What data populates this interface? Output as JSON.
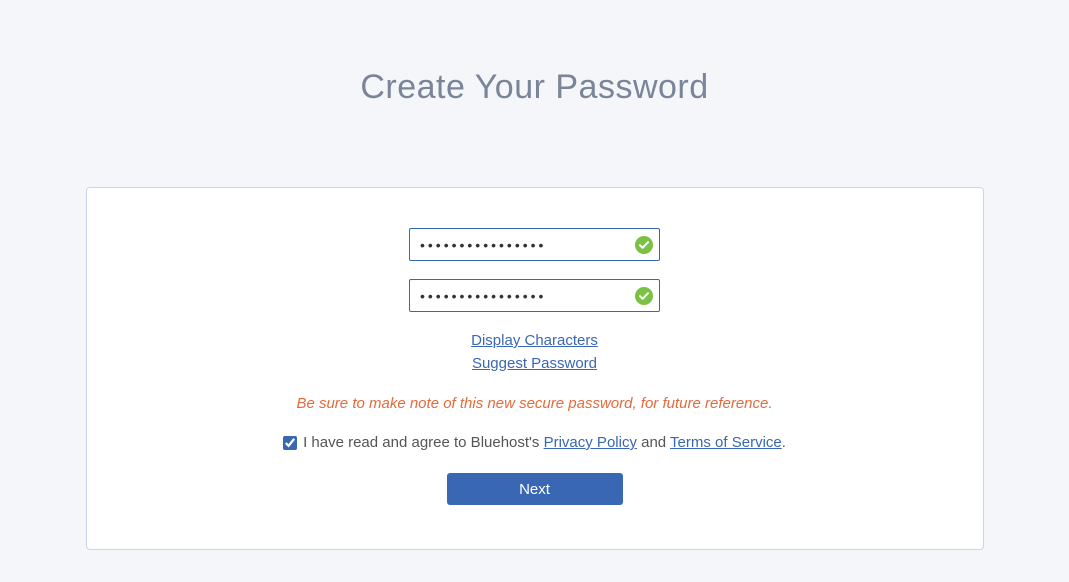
{
  "heading": "Create Your Password",
  "password": {
    "value": "••••••••••••••••",
    "valid": true
  },
  "confirm": {
    "value": "••••••••••••••••",
    "valid": true
  },
  "links": {
    "display_characters": "Display Characters",
    "suggest_password": "Suggest Password"
  },
  "note": "Be sure to make note of this new secure password, for future reference.",
  "agreement": {
    "checked": true,
    "prefix": "I have read and agree to Bluehost's ",
    "privacy_link": "Privacy Policy",
    "middle": " and ",
    "terms_link": "Terms of Service",
    "suffix": "."
  },
  "next_button": "Next"
}
